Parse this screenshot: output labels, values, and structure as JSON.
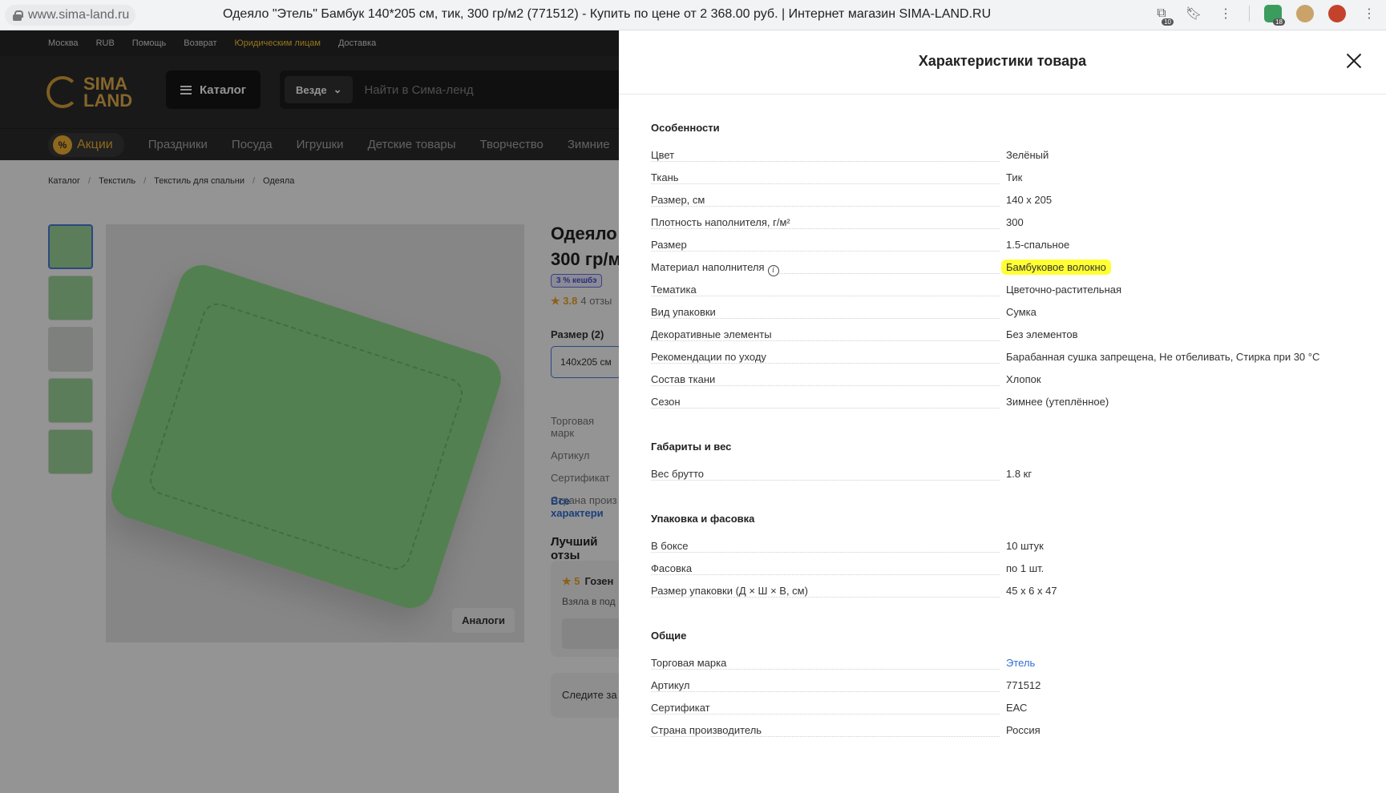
{
  "browser": {
    "url": "www.sima-land.ru",
    "tab_title": "Одеяло \"Этель\" Бамбук 140*205 см, тик, 300 гр/м2 (771512) - Купить по цене от 2 368.00 руб. | Интернет магазин SIMA-LAND.RU",
    "translate_badge": "10",
    "ext_badge": "18"
  },
  "site": {
    "topbar": [
      "Москва",
      "RUB",
      "Помощь",
      "Возврат",
      "Юридическим лицам",
      "Доставка"
    ],
    "logo_line1": "SIMA",
    "logo_line2": "LAND",
    "catalog_button": "Каталог",
    "search_scope": "Везде",
    "search_placeholder": "Найти в Сима-ленд",
    "promo": "Акции",
    "promo_icon": "%",
    "nav": [
      "Праздники",
      "Посуда",
      "Игрушки",
      "Детские товары",
      "Творчество",
      "Зимние"
    ],
    "breadcrumbs": [
      "Каталог",
      "Текстиль",
      "Текстиль для спальни",
      "Одеяла"
    ],
    "product_title": "Одеяло\n300 гр/м",
    "cashback": "3 % кешбэ",
    "rating_value": "3.8",
    "reviews_count": "4 отзы",
    "size_label": "Размер (2)",
    "size_value": "140x205 см",
    "mini_specs": [
      "Торговая марк",
      "Артикул",
      "Сертификат",
      "Страна произ"
    ],
    "all_chars_link": "Все характери",
    "best_review_label": "Лучший отзы",
    "review_stars": "5",
    "review_author": "Гозен",
    "review_text": "Взяла в под",
    "follow_label": "Следите за",
    "analogs_button": "Аналоги"
  },
  "panel": {
    "title": "Характеристики товара",
    "sections": [
      {
        "title": "Особенности",
        "rows": [
          {
            "k": "Цвет",
            "v": "Зелёный"
          },
          {
            "k": "Ткань",
            "v": "Тик"
          },
          {
            "k": "Размер, см",
            "v": "140 х 205"
          },
          {
            "k": "Плотность наполнителя, г/м²",
            "v": "300"
          },
          {
            "k": "Размер",
            "v": "1.5-спальное"
          },
          {
            "k": "Материал наполнителя",
            "v": "Бамбуковое волокно",
            "highlight": true,
            "info": true
          },
          {
            "k": "Тематика",
            "v": "Цветочно-растительная"
          },
          {
            "k": "Вид упаковки",
            "v": "Сумка"
          },
          {
            "k": "Декоративные элементы",
            "v": "Без элементов"
          },
          {
            "k": "Рекомендации по уходу",
            "v": "Барабанная сушка запрещена, Не отбеливать, Стирка при 30 °C"
          },
          {
            "k": "Состав ткани",
            "v": "Хлопок"
          },
          {
            "k": "Сезон",
            "v": "Зимнее (утеплённое)"
          }
        ]
      },
      {
        "title": "Габариты и вес",
        "rows": [
          {
            "k": "Вес брутто",
            "v": "1.8 кг"
          }
        ]
      },
      {
        "title": "Упаковка и фасовка",
        "rows": [
          {
            "k": "В боксе",
            "v": "10 штук"
          },
          {
            "k": "Фасовка",
            "v": "по 1 шт."
          },
          {
            "k": "Размер упаковки (Д × Ш × В, см)",
            "v": "45 х 6 х 47"
          }
        ]
      },
      {
        "title": "Общие",
        "rows": [
          {
            "k": "Торговая марка",
            "v": "Этель",
            "link": true
          },
          {
            "k": "Артикул",
            "v": "771512"
          },
          {
            "k": "Сертификат",
            "v": "ЕАС"
          },
          {
            "k": "Страна производитель",
            "v": "Россия"
          }
        ]
      }
    ]
  }
}
